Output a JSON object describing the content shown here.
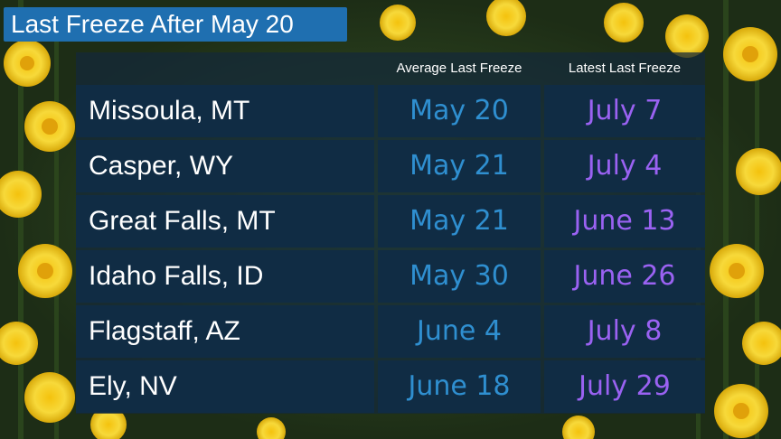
{
  "title": "Last Freeze After May 20",
  "columns": {
    "average": "Average Last Freeze",
    "latest": "Latest Last Freeze"
  },
  "rows": [
    {
      "city": "Missoula, MT",
      "average": "May 20",
      "latest": "July 7"
    },
    {
      "city": "Casper, WY",
      "average": "May 21",
      "latest": "July 4"
    },
    {
      "city": "Great Falls, MT",
      "average": "May 21",
      "latest": "June 13"
    },
    {
      "city": "Idaho Falls, ID",
      "average": "May 30",
      "latest": "June 26"
    },
    {
      "city": "Flagstaff, AZ",
      "average": "June 4",
      "latest": "July 8"
    },
    {
      "city": "Ely, NV",
      "average": "June 18",
      "latest": "July 29"
    }
  ],
  "colors": {
    "title_bg": "#1f6fb0",
    "average_text": "#2f8fd0",
    "latest_text": "#9a62f2",
    "cell_bg": "#102c44"
  }
}
